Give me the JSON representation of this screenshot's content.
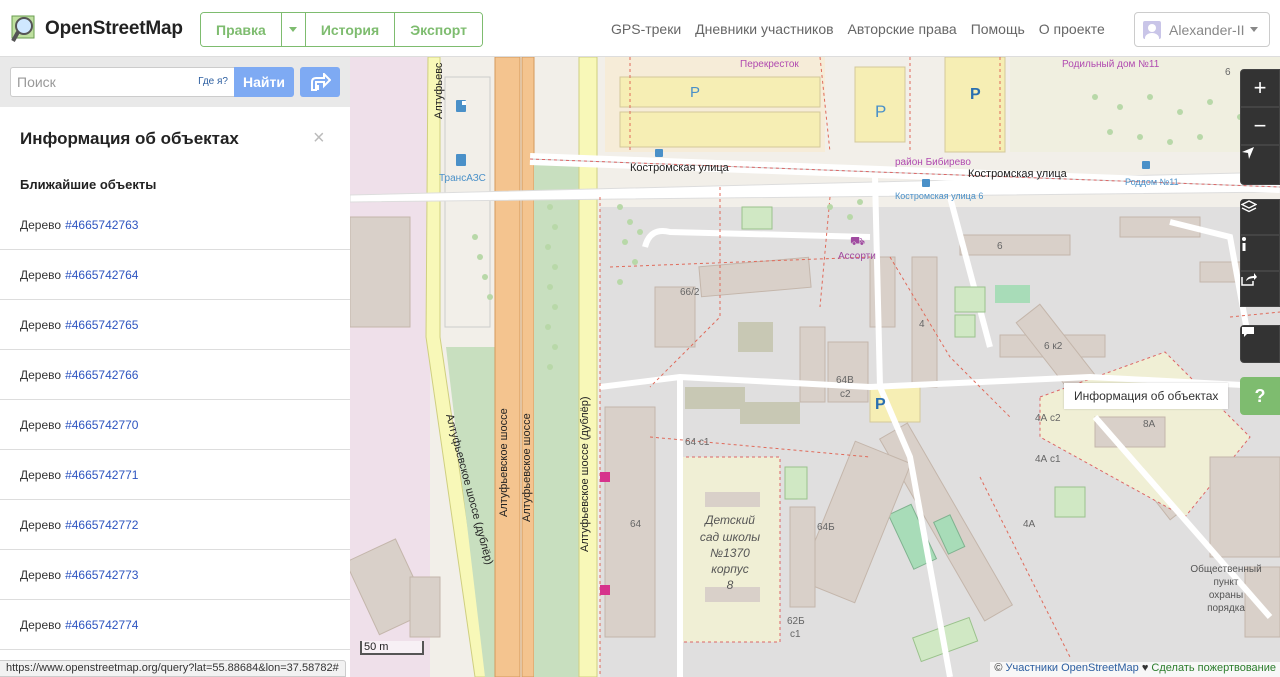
{
  "header": {
    "logo_text": "OpenStreetMap",
    "edit_label": "Правка",
    "history_label": "История",
    "export_label": "Экспорт",
    "nav": [
      "GPS-треки",
      "Дневники участников",
      "Авторские права",
      "Помощь",
      "О проекте"
    ],
    "user_name": "Alexander-II"
  },
  "search": {
    "placeholder": "Поиск",
    "where_am_i": "Где я?",
    "go_label": "Найти"
  },
  "panel": {
    "title": "Информация об объектах",
    "close": "×",
    "section": "Ближайшие объекты",
    "items": [
      {
        "type": "Дерево",
        "id": "#4665742763"
      },
      {
        "type": "Дерево",
        "id": "#4665742764"
      },
      {
        "type": "Дерево",
        "id": "#4665742765"
      },
      {
        "type": "Дерево",
        "id": "#4665742766"
      },
      {
        "type": "Дерево",
        "id": "#4665742770"
      },
      {
        "type": "Дерево",
        "id": "#4665742771"
      },
      {
        "type": "Дерево",
        "id": "#4665742772"
      },
      {
        "type": "Дерево",
        "id": "#4665742773"
      },
      {
        "type": "Дерево",
        "id": "#4665742774"
      }
    ]
  },
  "map": {
    "labels": {
      "perekrestok": "Перекресток",
      "roddom": "Родильный дом №11",
      "rayon": "район Бибирево",
      "kostromskaya1": "Костромская улица",
      "kostromskaya2": "Костромская улица",
      "kostromskaya_stop": "Костромская улица 6",
      "roddom_stop": "Роддом №11",
      "transazs": "ТрансАЗС",
      "assorti": "Ассорти",
      "altuf_dubler_left": "Алтуфьевское шоссе (дублёр)",
      "altuf1": "Алтуфьевское шоссе",
      "altuf2": "Алтуфьевское шоссе",
      "altuf_dubler_right": "Алтуфьевское шоссе (дублёр)",
      "altuf_top": "Алтуфьевс",
      "kindergarten": [
        "Детский",
        "сад школы",
        "№1370",
        "корпус",
        "8"
      ],
      "ohrana": [
        "Общественный",
        "пункт",
        "охраны",
        "порядка"
      ],
      "hn": [
        "6",
        "66/2",
        "4",
        "6 к2",
        "64В",
        "с2",
        "64 с1",
        "64",
        "64Б",
        "62Б",
        "с1",
        "4А с2",
        "4А с1",
        "4А",
        "8А",
        "6"
      ]
    },
    "tooltip": "Информация об объектах",
    "scale": "50 m",
    "attribution_copy": "©",
    "attribution_contributors": "Участники OpenStreetMap",
    "attribution_heart": "♥",
    "attribution_donate": "Сделать пожертвование"
  },
  "controls": {
    "zoom_in": "+",
    "zoom_out": "−",
    "help": "?"
  },
  "status_url": "https://www.openstreetmap.org/query?lat=55.88684&lon=37.58782#"
}
